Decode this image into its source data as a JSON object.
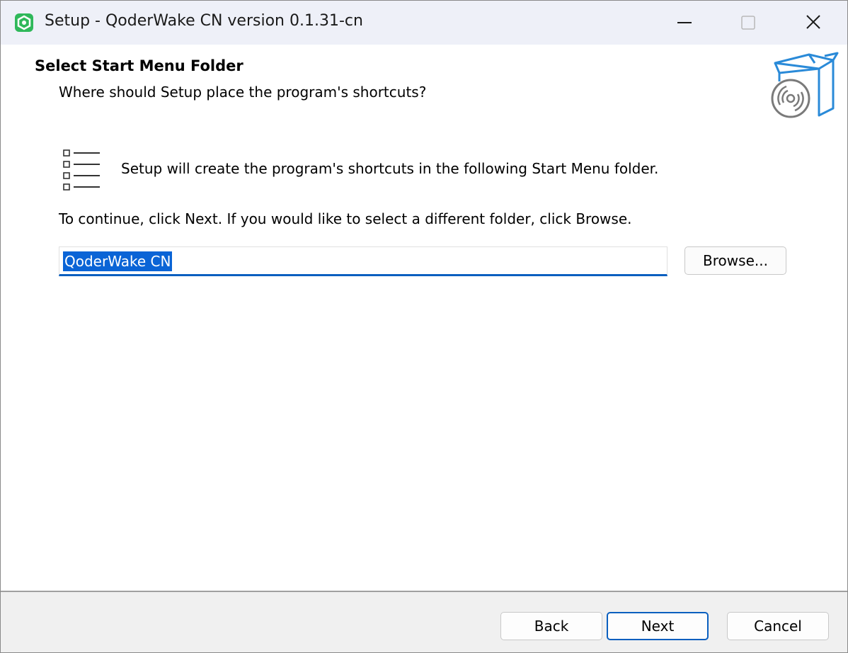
{
  "window": {
    "title": "Setup - QoderWake CN version 0.1.31-cn",
    "app_icon": "qoderwake-app-icon",
    "controls": {
      "minimize_icon": "minimize-icon",
      "maximize_icon": "maximize-icon",
      "close_icon": "close-icon"
    }
  },
  "header": {
    "title": "Select Start Menu Folder",
    "subtitle": "Where should Setup place the program's shortcuts?",
    "icon": "software-box-icon"
  },
  "body": {
    "list_icon": "list-icon",
    "info_text": "Setup will create the program's shortcuts in the following Start Menu folder.",
    "instruction_text": "To continue, click Next. If you would like to select a different folder, click Browse.",
    "folder_input": {
      "value": "QoderWake CN",
      "selected": true
    },
    "browse_label": "Browse..."
  },
  "footer": {
    "back_label": "Back",
    "next_label": "Next",
    "cancel_label": "Cancel"
  },
  "colors": {
    "accent": "#0a5fbf",
    "selection": "#0a64d6",
    "titlebar_bg": "#eef0f8",
    "footer_bg": "#f0f0f0",
    "app_icon": "#2fb85a",
    "box_icon": "#2a8ad8"
  }
}
